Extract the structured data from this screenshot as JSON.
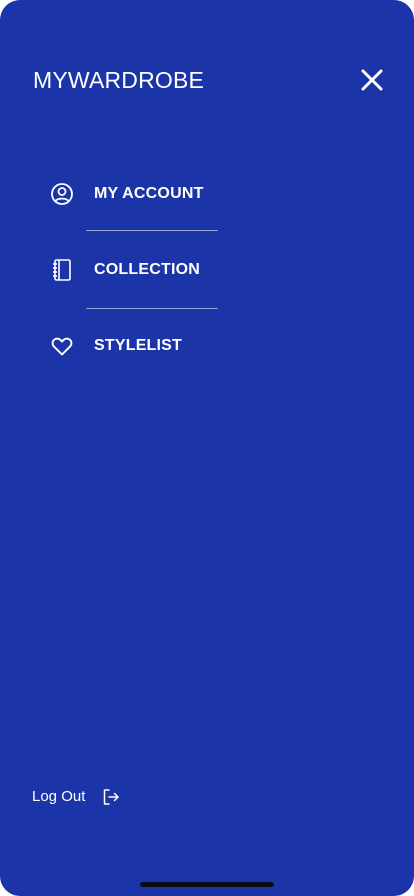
{
  "header": {
    "brand": "MYWARDROBE",
    "close_icon": "close-icon"
  },
  "menu": {
    "items": [
      {
        "label": "MY ACCOUNT",
        "icon": "user-circle-icon"
      },
      {
        "label": "COLLECTION",
        "icon": "notebook-icon"
      },
      {
        "label": "STYLELIST",
        "icon": "heart-icon"
      }
    ]
  },
  "footer": {
    "logout_label": "Log Out",
    "logout_icon": "logout-icon"
  },
  "colors": {
    "background": "#1b35a8",
    "text": "#ffffff"
  }
}
